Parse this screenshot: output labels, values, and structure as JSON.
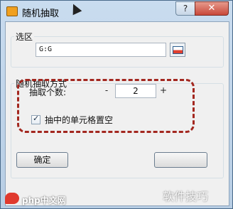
{
  "window": {
    "title": "随机抽取",
    "help_label": "?",
    "close_label": "✕"
  },
  "selection": {
    "legend": "选区",
    "value": "G:G",
    "button_icon": "range-select-icon"
  },
  "mode": {
    "legend": "随机抽取方式",
    "count_label": "抽取个数:",
    "decrement": "-",
    "count": "2",
    "increment": "+",
    "clear_label": "抽中的单元格置空",
    "clear_checked": true
  },
  "buttons": {
    "ok": "确定"
  },
  "watermark": {
    "left": "php中文网",
    "right": "软件技巧"
  },
  "colors": {
    "highlight": "#a3271f",
    "close": "#c8483a"
  }
}
